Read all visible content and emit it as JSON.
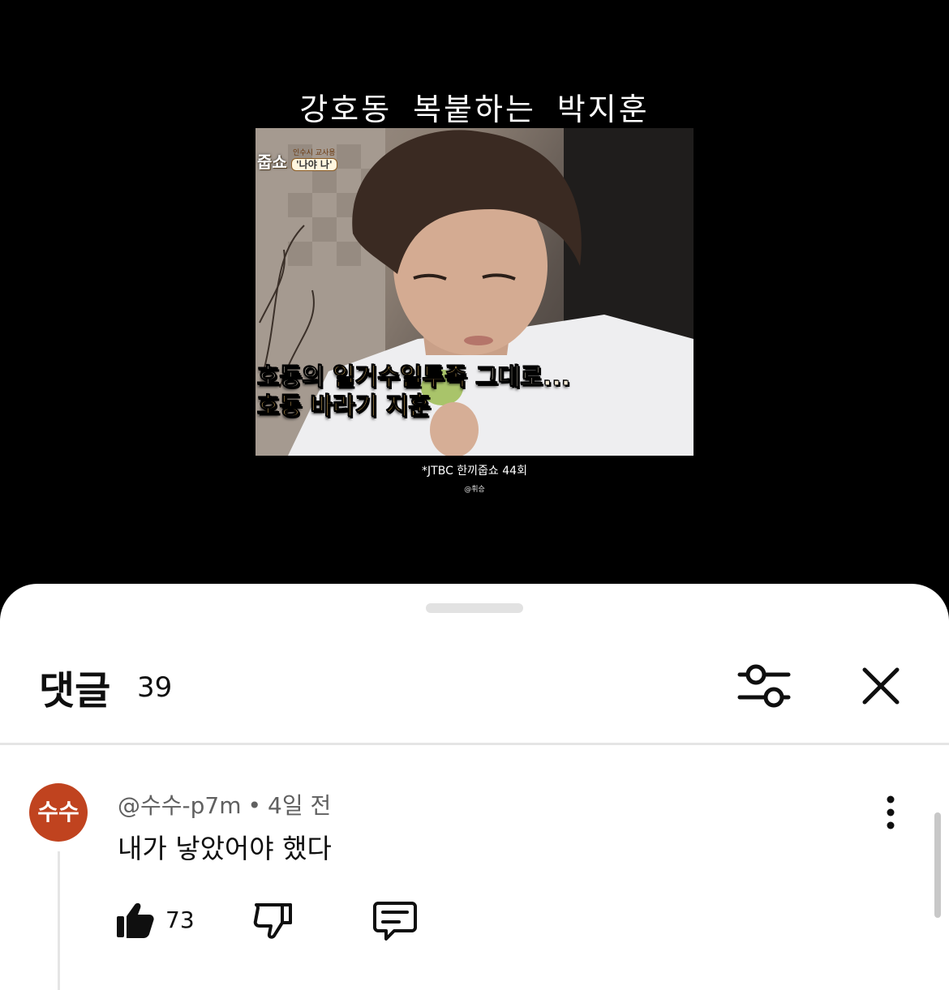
{
  "video": {
    "title": "강호동 복붙하는 박지훈",
    "show_logo": "줍쇼",
    "episode_tag_small": "인수시 교사용",
    "episode_tag_main": "'나야 나'",
    "subtitle_line1_a": "호동의 ",
    "subtitle_line1_b": "일거수일투족",
    "subtitle_line1_c": " 그대로...",
    "subtitle_line2": "호동 바라기 지훈",
    "source_caption": "*JTBC 한끼줍쇼 44회",
    "credit": "@휘승"
  },
  "comments_panel": {
    "title": "댓글",
    "count": "39",
    "filter_icon": "sliders-icon",
    "close_icon": "close-icon"
  },
  "comment": {
    "avatar_text": "수수",
    "avatar_color": "#c0431f",
    "author": "@수수-p7m",
    "separator": "•",
    "time": "4일 전",
    "text": "내가 낳았어야 했다",
    "like_count": "73",
    "icons": [
      "thumbs-up-icon",
      "thumbs-down-icon",
      "reply-icon",
      "more-vert-icon"
    ]
  }
}
